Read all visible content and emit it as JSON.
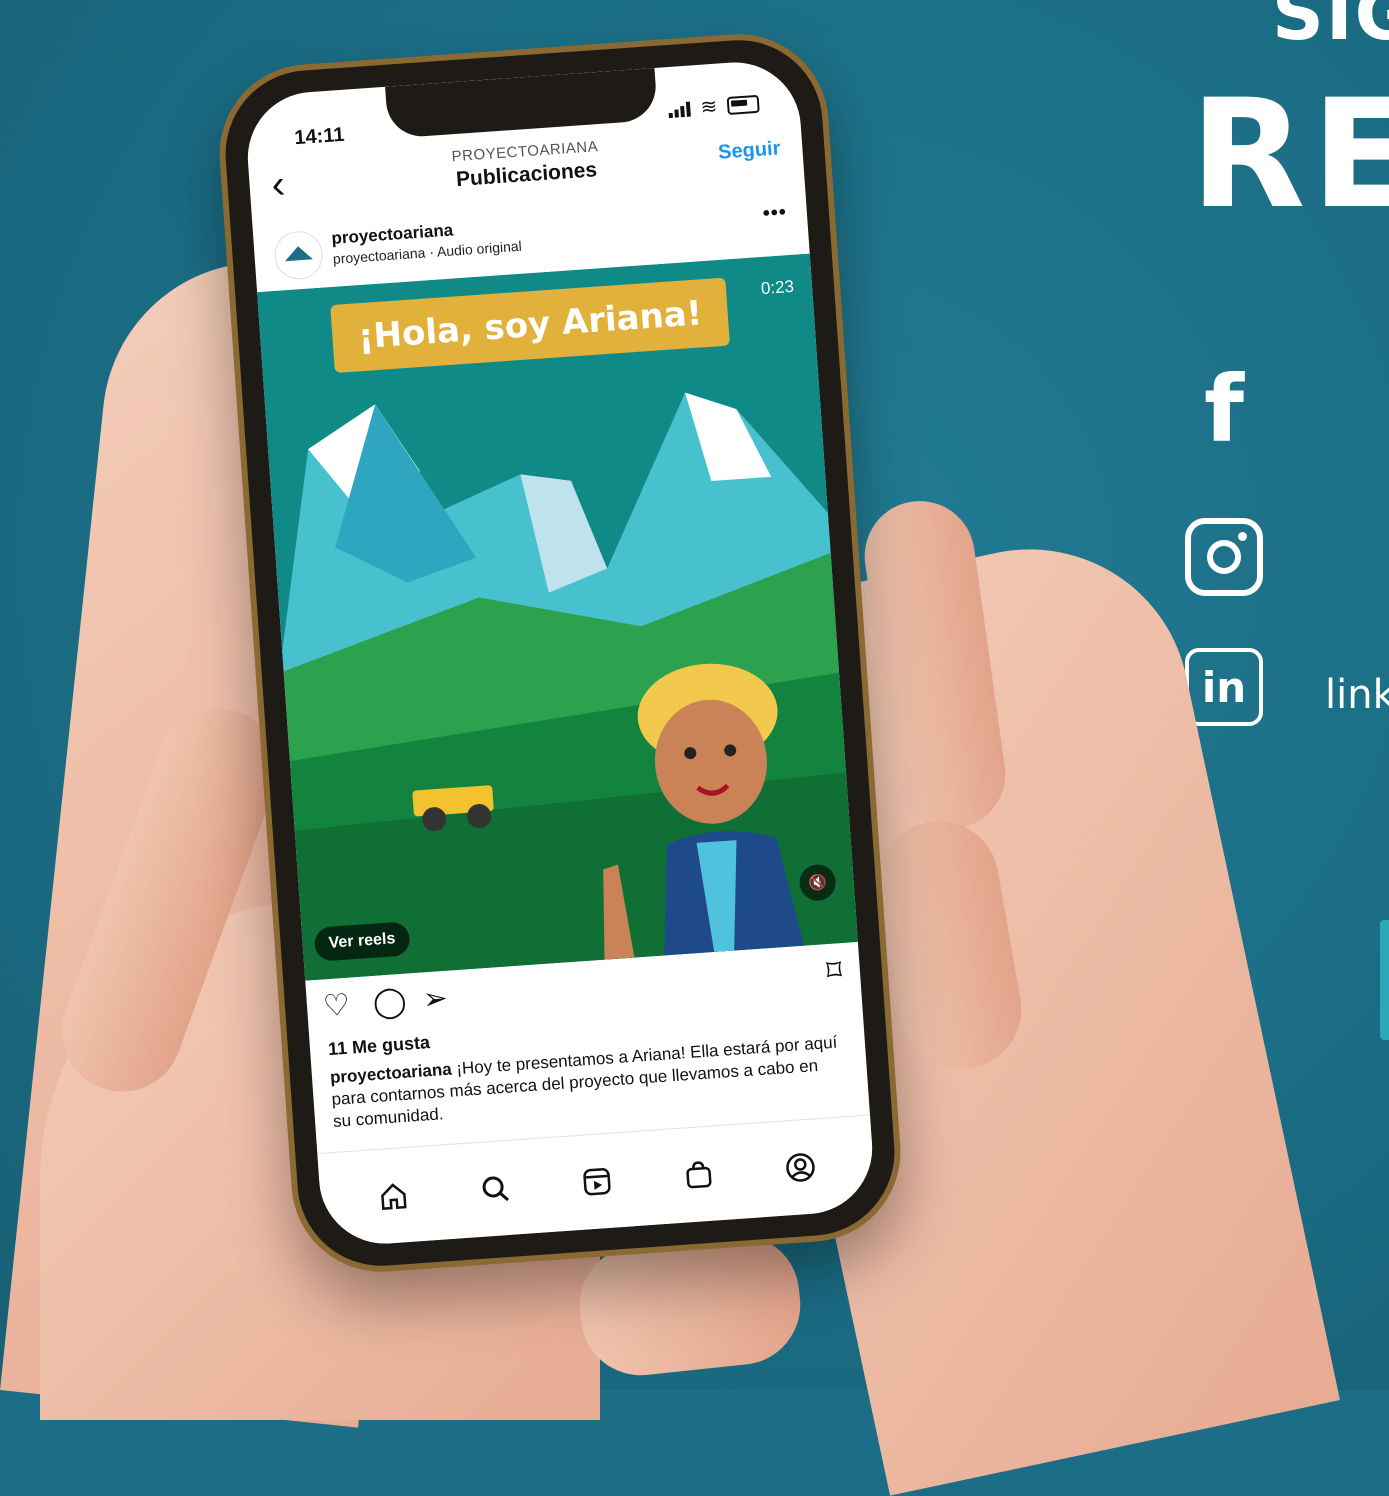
{
  "right_panel": {
    "headline_top": "SIG",
    "headline_main": "RE",
    "social": {
      "facebook_glyph": "f",
      "linkedin_glyph": "in",
      "linkedin_text": "link"
    }
  },
  "phone": {
    "status": {
      "time": "14:11"
    },
    "header": {
      "subtitle": "PROYECTOARIANA",
      "title": "Publicaciones",
      "follow": "Seguir"
    },
    "post": {
      "username": "proyectoariana",
      "audio": "proyectoariana · Audio original",
      "more": "•••",
      "banner": "¡Hola, soy Ariana!",
      "duration": "0:23",
      "reels_button": "Ver reels",
      "likes": "11 Me gusta",
      "caption_user": "proyectoariana",
      "caption_text": "¡Hoy te presentamos a Ariana! Ella estará por aquí para contarnos más acerca del proyecto que llevamos a cabo en su comunidad."
    },
    "icons": {
      "back": "chevron-left-icon",
      "like": "heart-icon",
      "comment": "comment-icon",
      "share": "send-icon",
      "save": "bookmark-icon",
      "mute": "speaker-muted-icon",
      "nav": [
        "home-icon",
        "search-icon",
        "reels-icon",
        "shop-icon",
        "profile-icon"
      ]
    },
    "colors": {
      "follow": "#1a95f0",
      "banner": "#e1b13c",
      "background": "#1b6e86"
    }
  }
}
